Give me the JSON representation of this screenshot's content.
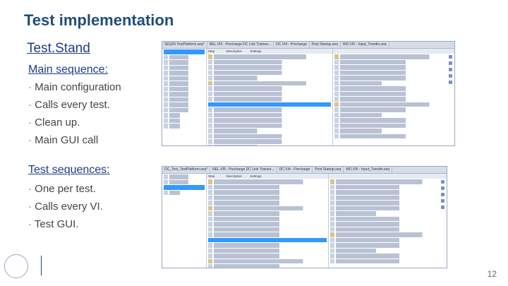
{
  "slide": {
    "title": "Test implementation",
    "subtitle": "Test.Stand",
    "page_number": "12"
  },
  "main_sequence": {
    "heading": "Main sequence:",
    "items": [
      "Main configuration",
      "Calls every test.",
      "Clean up.",
      "Main GUI call"
    ]
  },
  "test_sequences": {
    "heading": "Test sequences:",
    "items": [
      "One per test.",
      "Calls every VI.",
      "Test GUI."
    ]
  },
  "screenshot1": {
    "tabs": [
      "SEQ00 TestPlatform.seq*",
      "NEL.VI5 - Precharge DC Link Trainee...",
      "DC.VI4 - Precharge",
      "Post Startup.seq",
      "WD.VI5 - Input_Trendin.seq"
    ],
    "columns": [
      "Step",
      "Description",
      "Settings"
    ]
  },
  "screenshot2": {
    "tabs": [
      "DC_Test_TestPlatform.seq*",
      "NEL.VI5 - Precharge DC Link Trainee...",
      "DC.VI4 - Precharge",
      "Post Startup.seq",
      "WD.VI5 - Input_Trendin.seq"
    ],
    "columns": [
      "Step",
      "Description",
      "Settings"
    ]
  }
}
